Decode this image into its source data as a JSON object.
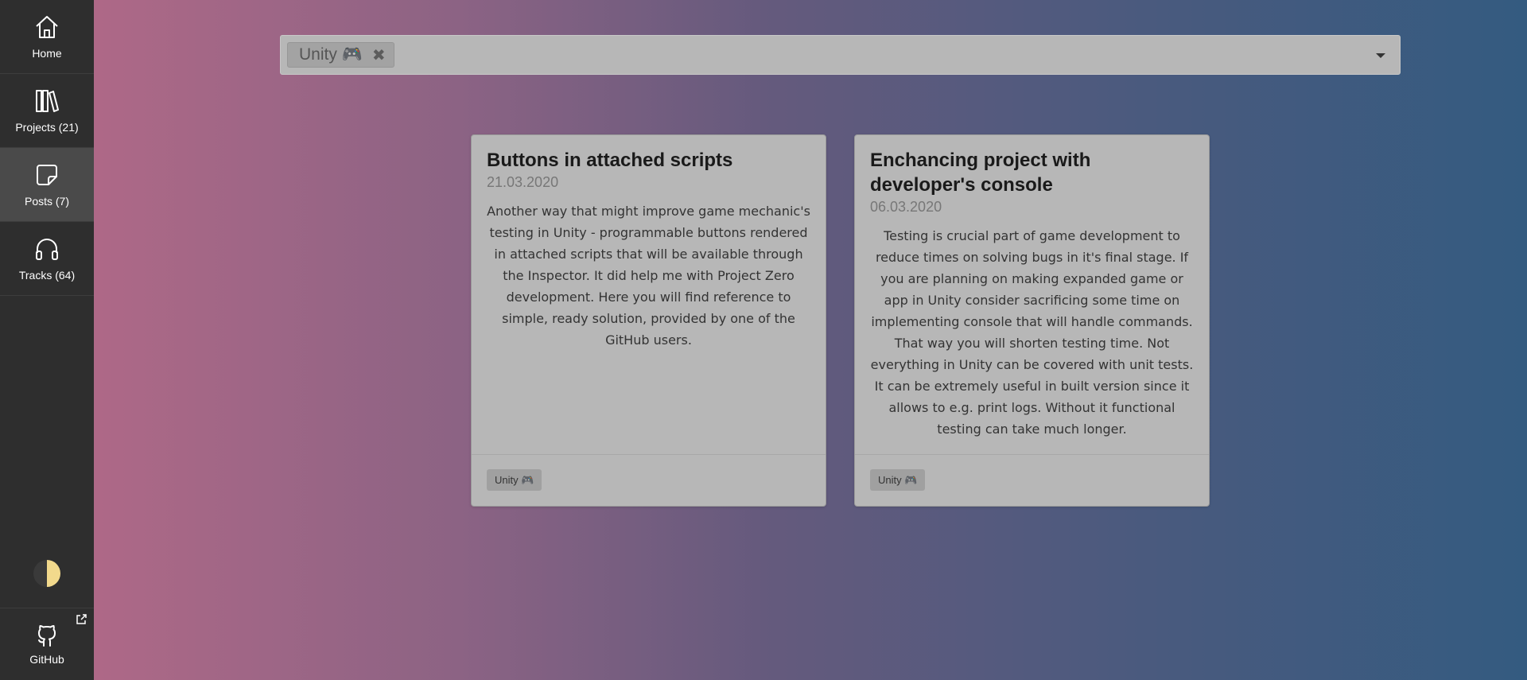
{
  "sidebar": {
    "items": [
      {
        "label": "Home",
        "icon": "home-icon"
      },
      {
        "label": "Projects (21)",
        "icon": "books-icon"
      },
      {
        "label": "Posts (7)",
        "icon": "sticky-note-icon",
        "active": true
      },
      {
        "label": "Tracks (64)",
        "icon": "headphones-icon"
      }
    ],
    "theme_toggle_icon": "half-moon-icon",
    "github": {
      "label": "GitHub",
      "icon": "github-icon",
      "external_icon": "external-link-icon"
    }
  },
  "filter": {
    "chip_label": "Unity 🎮",
    "remove_icon": "✖"
  },
  "posts": [
    {
      "title": "Buttons in attached scripts",
      "date": "21.03.2020",
      "text": "Another way that might improve game mechanic's testing in Unity - programmable buttons rendered in attached scripts that will be available through the Inspector. It did help me with Project Zero development. Here you will find reference to simple, ready solution, provided by one of the GitHub users.",
      "tag": "Unity 🎮"
    },
    {
      "title": "Enchancing project with developer's console",
      "date": "06.03.2020",
      "text": "Testing is crucial part of game development to reduce times on solving bugs in it's final stage. If you are planning on making expanded game or app in Unity consider sacrificing some time on implementing console that will handle commands. That way you will shorten testing time. Not everything in Unity can be covered with unit tests. It can be extremely useful in built version since it allows to e.g. print logs. Without it functional testing can take much longer.",
      "tag": "Unity 🎮"
    }
  ],
  "colors": {
    "sidebar_bg": "#2e2e2e",
    "sidebar_active": "#4a4a4a",
    "gradient_start": "#b76a88",
    "gradient_end": "#345b80",
    "card_bg": "#b7b7b7"
  }
}
